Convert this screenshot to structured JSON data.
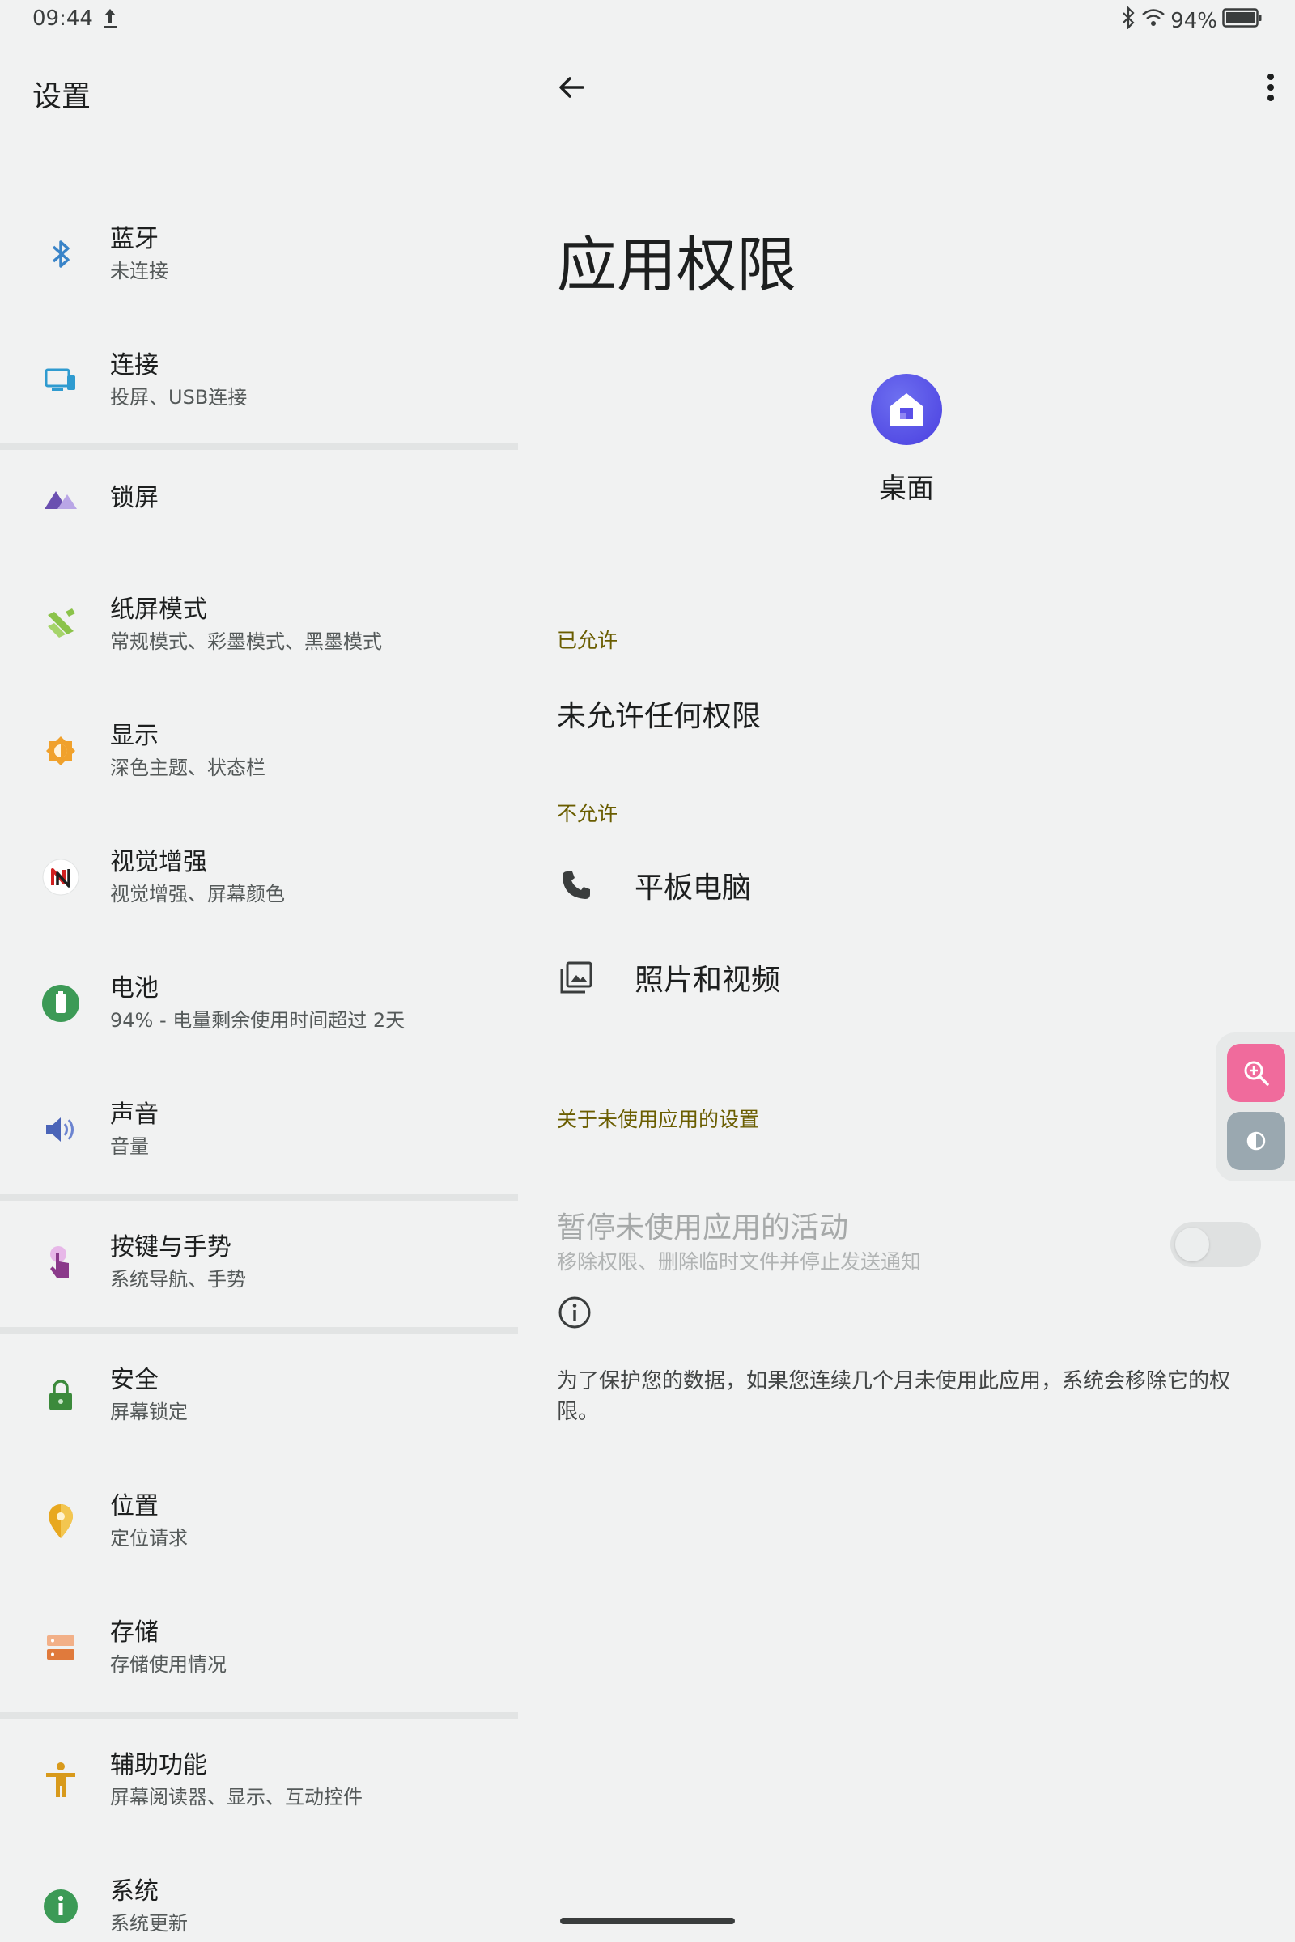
{
  "status_bar": {
    "time": "09:44",
    "battery": "94%",
    "icons": [
      "upload-icon",
      "bluetooth-icon",
      "wifi-icon",
      "battery-icon"
    ]
  },
  "left": {
    "title": "设置",
    "items": [
      {
        "label": "蓝牙",
        "sub": "未连接",
        "icon": "bluetooth-icon",
        "color": "#3a84c8"
      },
      {
        "label": "连接",
        "sub": "投屏、USB连接",
        "icon": "devices-icon",
        "color": "#2f9bd0"
      },
      {
        "label": "锁屏",
        "sub": "",
        "icon": "lockscreen-icon",
        "color": "#6a4fb0"
      },
      {
        "label": "纸屏模式",
        "sub": "常规模式、彩墨模式、黑墨模式",
        "icon": "paper-mode-icon",
        "color": "#8bc34a"
      },
      {
        "label": "显示",
        "sub": "深色主题、状态栏",
        "icon": "display-icon",
        "color": "#f0a12c"
      },
      {
        "label": "视觉增强",
        "sub": "视觉增强、屏幕颜色",
        "icon": "visual-enhance-icon",
        "color": "#d02020"
      },
      {
        "label": "电池",
        "sub": "94% - 电量剩余使用时间超过 2天",
        "icon": "battery-icon",
        "color": "#3c9a56"
      },
      {
        "label": "声音",
        "sub": "音量",
        "icon": "sound-icon",
        "color": "#4a64b8"
      },
      {
        "label": "按键与手势",
        "sub": "系统导航、手势",
        "icon": "gesture-icon",
        "color": "#8a3a8a"
      },
      {
        "label": "安全",
        "sub": "屏幕锁定",
        "icon": "lock-icon",
        "color": "#3c8a3c"
      },
      {
        "label": "位置",
        "sub": "定位请求",
        "icon": "location-icon",
        "color": "#e8a820"
      },
      {
        "label": "存储",
        "sub": "存储使用情况",
        "icon": "storage-icon",
        "color": "#e07a3c"
      },
      {
        "label": "辅助功能",
        "sub": "屏幕阅读器、显示、互动控件",
        "icon": "accessibility-icon",
        "color": "#d89a1c"
      },
      {
        "label": "系统",
        "sub": "系统更新",
        "icon": "info-icon",
        "color": "#3c9a56"
      }
    ]
  },
  "right": {
    "page_title": "应用权限",
    "app_name": "桌面",
    "allowed_header": "已允许",
    "allowed_none": "未允许任何权限",
    "denied_header": "不允许",
    "denied": [
      {
        "label": "平板电脑",
        "icon": "phone-icon"
      },
      {
        "label": "照片和视频",
        "icon": "photos-icon"
      }
    ],
    "unused_header": "关于未使用应用的设置",
    "toggle_title": "暂停未使用应用的活动",
    "toggle_sub": "移除权限、删除临时文件并停止发送通知",
    "info_text": "为了保护您的数据，如果您连续几个月未使用此应用，系统会移除它的权限。"
  },
  "floating": {
    "zoom_color": "#f06b9c",
    "contrast_color": "#9aa8b0"
  },
  "colors": {
    "background": "#f1f2f2",
    "section_label": "#6a5d00",
    "app_icon": "#4a3fe0"
  }
}
